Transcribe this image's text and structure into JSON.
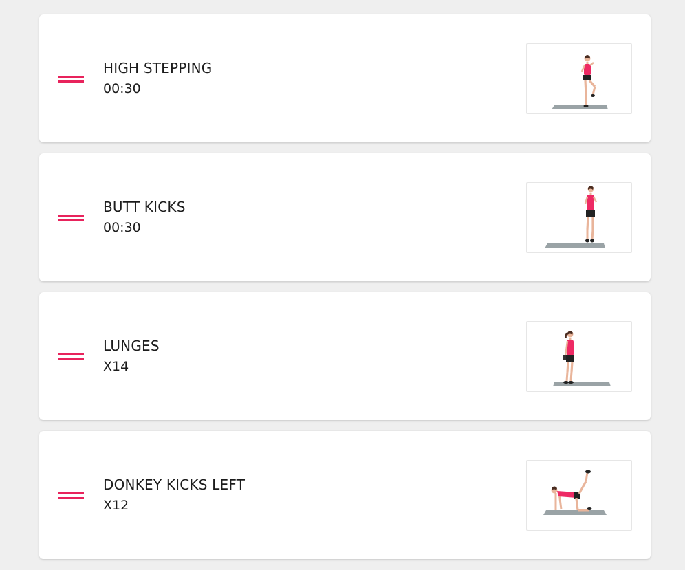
{
  "colors": {
    "accent": "#e8235c",
    "background": "#efefef",
    "card": "#ffffff"
  },
  "exercises": [
    {
      "name": "HIGH STEPPING",
      "amount": "00:30",
      "image": "high-stepping-figure"
    },
    {
      "name": "BUTT KICKS",
      "amount": "00:30",
      "image": "butt-kicks-figure"
    },
    {
      "name": "LUNGES",
      "amount": "X14",
      "image": "lunges-figure"
    },
    {
      "name": "DONKEY KICKS LEFT",
      "amount": "X12",
      "image": "donkey-kicks-figure"
    }
  ]
}
